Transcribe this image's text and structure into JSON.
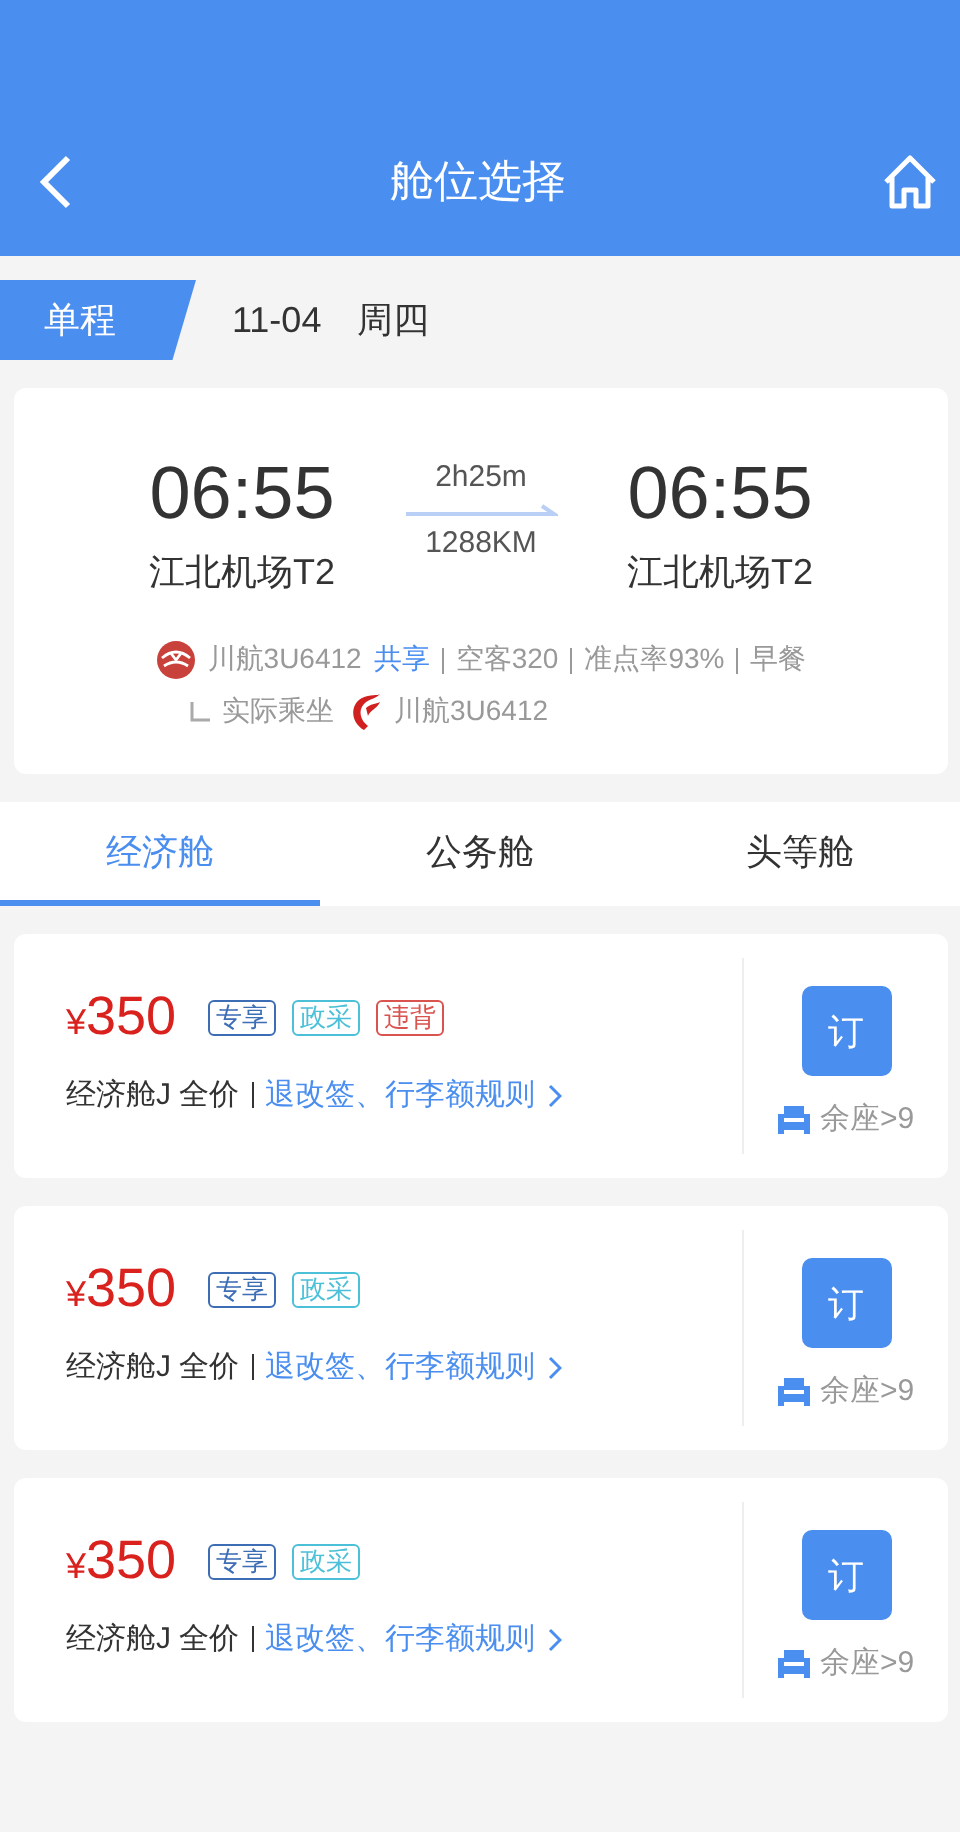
{
  "header": {
    "title": "舱位选择"
  },
  "trip": {
    "type_label": "单程",
    "date": "11-04",
    "weekday": "周四"
  },
  "flight": {
    "depart_time": "06:55",
    "depart_airport": "江北机场T2",
    "duration": "2h25m",
    "distance": "1288KM",
    "arrive_time": "06:55",
    "arrive_airport": "江北机场T2",
    "airline": "川航3U6412",
    "share_badge": "共享",
    "details": [
      "空客320",
      "准点率93%",
      "早餐"
    ],
    "actual_label": "实际乘坐",
    "actual_airline": "川航3U6412"
  },
  "tabs": [
    {
      "label": "经济舱",
      "selected": true
    },
    {
      "label": "公务舱",
      "selected": false
    },
    {
      "label": "头等舱",
      "selected": false
    }
  ],
  "fares": [
    {
      "currency": "¥",
      "amount": "350",
      "tags": [
        {
          "label": "专享",
          "color": "#3d6db5"
        },
        {
          "label": "政采",
          "color": "#4cc0d8"
        },
        {
          "label": "违背",
          "color": "#d9534f"
        }
      ],
      "cabin": "经济舱J 全价",
      "rules_link": "退改签、行李额规则",
      "book_label": "订",
      "seats": "余座>9"
    },
    {
      "currency": "¥",
      "amount": "350",
      "tags": [
        {
          "label": "专享",
          "color": "#3d6db5"
        },
        {
          "label": "政采",
          "color": "#4cc0d8"
        }
      ],
      "cabin": "经济舱J 全价",
      "rules_link": "退改签、行李额规则",
      "book_label": "订",
      "seats": "余座>9"
    },
    {
      "currency": "¥",
      "amount": "350",
      "tags": [
        {
          "label": "专享",
          "color": "#3d6db5"
        },
        {
          "label": "政采",
          "color": "#4cc0d8"
        }
      ],
      "cabin": "经济舱J 全价",
      "rules_link": "退改签、行李额规则",
      "book_label": "订",
      "seats": "余座>9"
    }
  ]
}
